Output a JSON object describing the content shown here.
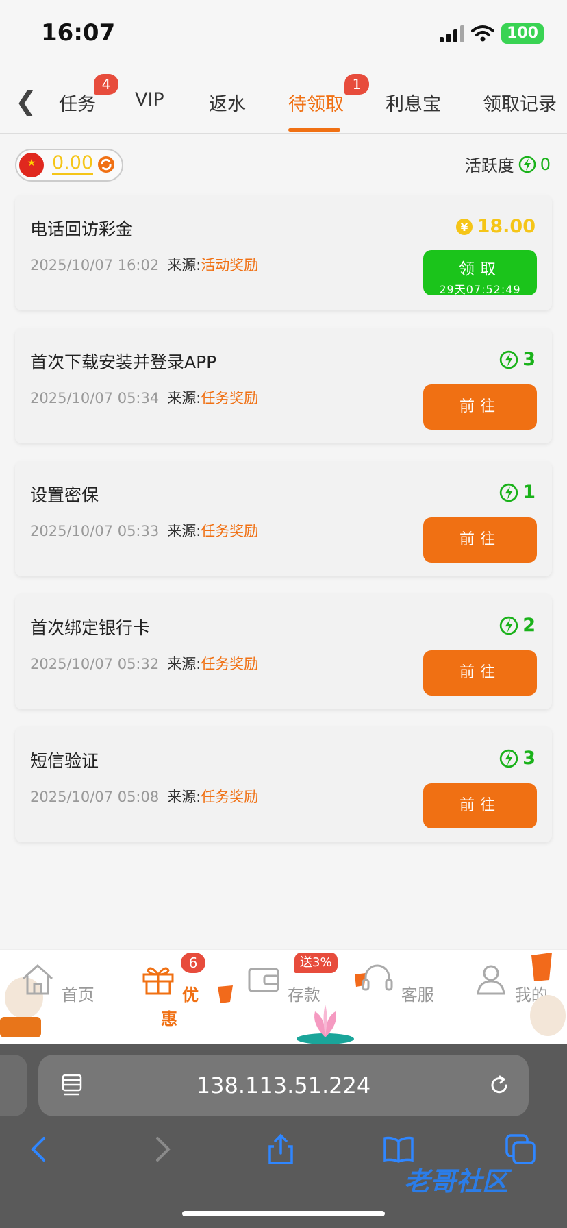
{
  "status_bar": {
    "time": "16:07",
    "battery": "100"
  },
  "tabs": {
    "items": [
      {
        "label": "任务",
        "badge": "4"
      },
      {
        "label": "VIP"
      },
      {
        "label": "返水"
      },
      {
        "label": "待领取",
        "badge": "1",
        "active": true
      },
      {
        "label": "利息宝"
      },
      {
        "label": "领取记录"
      }
    ]
  },
  "wallet": {
    "amount": "0.00"
  },
  "activity": {
    "label": "活跃度",
    "value": "0"
  },
  "cards": [
    {
      "title": "电话回访彩金",
      "time": "2025/10/07 16:02",
      "source_label": "来源:",
      "source": "活动奖励",
      "reward": "18.00",
      "reward_type": "coin",
      "button": "领取",
      "countdown": "29天07:52:49"
    },
    {
      "title": "首次下载安装并登录APP",
      "time": "2025/10/07 05:34",
      "source_label": "来源:",
      "source": "任务奖励",
      "reward": "3",
      "reward_type": "activity",
      "button": "前往"
    },
    {
      "title": "设置密保",
      "time": "2025/10/07 05:33",
      "source_label": "来源:",
      "source": "任务奖励",
      "reward": "1",
      "reward_type": "activity",
      "button": "前往"
    },
    {
      "title": "首次绑定银行卡",
      "time": "2025/10/07 05:32",
      "source_label": "来源:",
      "source": "任务奖励",
      "reward": "2",
      "reward_type": "activity",
      "button": "前往"
    },
    {
      "title": "短信验证",
      "time": "2025/10/07 05:08",
      "source_label": "来源:",
      "source": "任务奖励",
      "reward": "3",
      "reward_type": "activity",
      "button": "前往"
    }
  ],
  "bottom_nav": {
    "items": [
      {
        "label": "首页"
      },
      {
        "label": "优惠",
        "badge": "6",
        "active": true
      },
      {
        "label": "存款",
        "badge": "送3%"
      },
      {
        "label": "客服"
      },
      {
        "label": "我的"
      }
    ]
  },
  "browser": {
    "url": "138.113.51.224"
  },
  "watermark": "老哥社区",
  "colors": {
    "accent": "#f07013",
    "green": "#1bc41b",
    "gold": "#f5c518",
    "badge": "#e74c3c"
  }
}
